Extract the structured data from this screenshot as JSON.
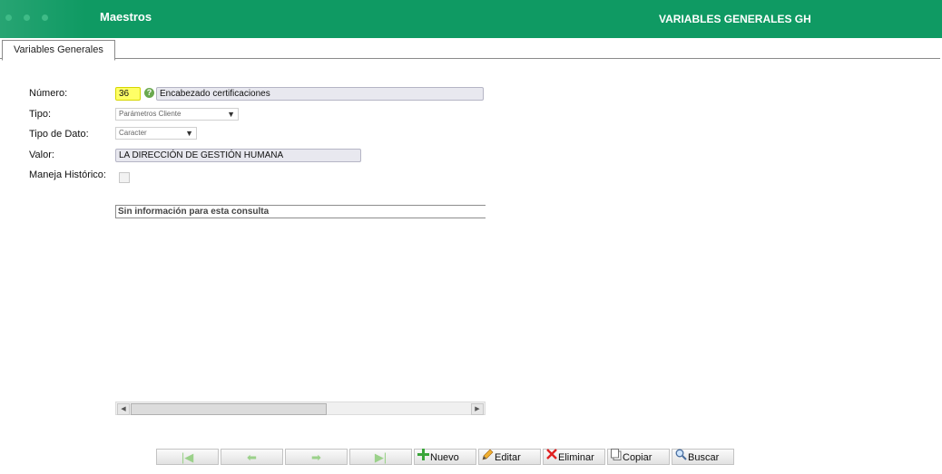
{
  "header": {
    "module": "Maestros",
    "screen_title": "VARIABLES GENERALES GH",
    "brand_color": "#0f9a63"
  },
  "tabs": [
    {
      "label": "Variables Generales",
      "active": true
    }
  ],
  "form": {
    "numero": {
      "label": "Número:",
      "value": "36",
      "description": "Encabezado certificaciones"
    },
    "tipo": {
      "label": "Tipo:",
      "selected": "Parámetros Cliente"
    },
    "tipo_dato": {
      "label": "Tipo de Dato:",
      "selected": "Caracter"
    },
    "valor": {
      "label": "Valor:",
      "value": "LA DIRECCIÓN DE GESTIÓN HUMANA"
    },
    "historico": {
      "label": "Maneja Histórico:",
      "checked": false
    }
  },
  "grid": {
    "empty_message": "Sin información para esta consulta"
  },
  "toolbar": {
    "first": "first-record-icon",
    "prev": "previous-record-icon",
    "next": "next-record-icon",
    "last": "last-record-icon",
    "nuevo": "Nuevo",
    "editar": "Editar",
    "eliminar": "Eliminar",
    "copiar": "Copiar",
    "buscar": "Buscar"
  }
}
